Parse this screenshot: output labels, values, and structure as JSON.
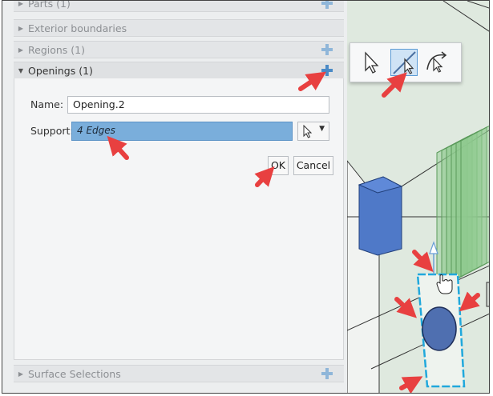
{
  "panel": {
    "sections": [
      {
        "label": "Parts (1)",
        "expanded": false
      },
      {
        "label": "Exterior boundaries",
        "expanded": false
      },
      {
        "label": "Regions (1)",
        "expanded": false
      },
      {
        "label": "Openings (1)",
        "expanded": true
      },
      {
        "label": "Surface Selections",
        "expanded": false
      }
    ],
    "name_label": "Name:",
    "name_value": "Opening.2",
    "support_label": "Support:",
    "support_value": "4 Edges",
    "ok_label": "OK",
    "cancel_label": "Cancel"
  },
  "toolbar": {
    "tools": [
      "select-arrow-icon",
      "edge-select-icon",
      "surface-select-icon"
    ],
    "active_tool": "edge-select-icon"
  },
  "colors": {
    "accent_blue": "#4a8ac6",
    "support_highlight": "#7aaedb",
    "annotation_red": "#e84040",
    "viewport_green": "#dde8dd"
  }
}
